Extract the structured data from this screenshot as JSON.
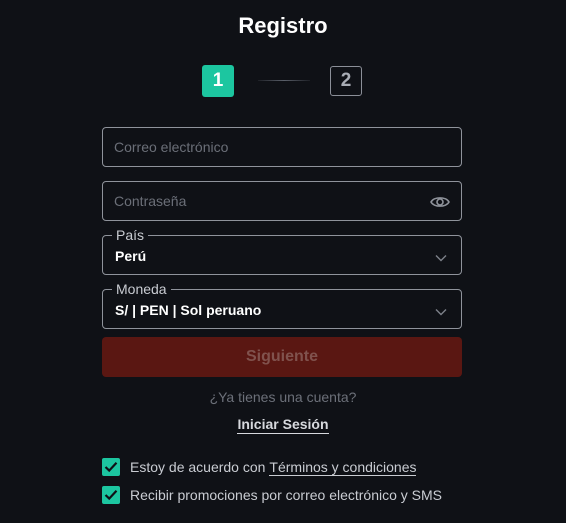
{
  "page": {
    "title": "Registro"
  },
  "stepper": {
    "step1": "1",
    "step2": "2",
    "active_step": 1
  },
  "form": {
    "email": {
      "placeholder": "Correo electrónico",
      "value": ""
    },
    "password": {
      "placeholder": "Contraseña",
      "value": "",
      "icon": "eye-icon"
    },
    "country": {
      "label": "País",
      "value": "Perú",
      "icon": "chevron-down-icon"
    },
    "currency": {
      "label": "Moneda",
      "value": "S/ | PEN | Sol peruano",
      "icon": "chevron-down-icon"
    }
  },
  "actions": {
    "next_label": "Siguiente",
    "have_account_text": "¿Ya tienes una cuenta?",
    "login_label": "Iniciar Sesión"
  },
  "consents": {
    "terms_prefix": "Estoy de acuerdo con",
    "terms_link": "Términos y condiciones",
    "terms_checked": true,
    "promo_text": "Recibir promociones por correo electrónico y SMS",
    "promo_checked": true
  },
  "colors": {
    "background": "#0f1116",
    "accent": "#1cc6a0",
    "button_disabled_bg": "#5a1712",
    "button_disabled_text": "#80524d",
    "border": "#8f939b"
  }
}
